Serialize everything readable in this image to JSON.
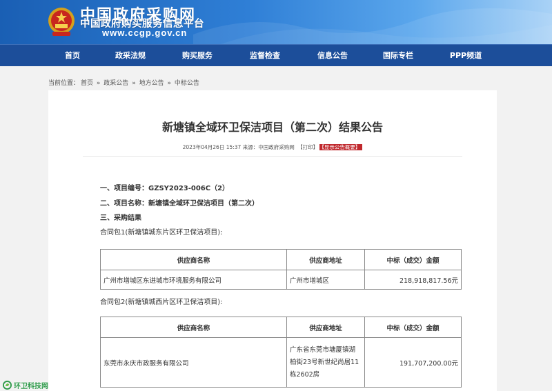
{
  "header": {
    "site_title": "中国政府采购网",
    "site_subtitle": "中国政府购买服务信息平台",
    "site_url": "www.ccgp.gov.cn"
  },
  "nav": {
    "items": [
      "首页",
      "政采法规",
      "购买服务",
      "监督检查",
      "信息公告",
      "国际专栏",
      "PPP频道"
    ]
  },
  "breadcrumb": {
    "label": "当前位置：",
    "items": [
      "首页",
      "政采公告",
      "地方公告",
      "中标公告"
    ],
    "separator": "»"
  },
  "article": {
    "title": "新塘镇全域环卫保洁项目（第二次）结果公告",
    "meta_date": "2023年04月26日 15:37 来源：",
    "meta_source": "中国政府采购网",
    "print_label": "【打印】",
    "summary_label": "【显示公告概要】",
    "sections": {
      "project_no": "一、项目编号：GZSY2023-006C（2）",
      "project_name": "二、项目名称：新塘镇全域环卫保洁项目（第二次）",
      "result": "三、采购结果",
      "package1": "合同包1(新塘镇城东片区环卫保洁项目):",
      "package2": "合同包2(新塘镇城西片区环卫保洁项目):"
    },
    "table_headers": [
      "供应商名称",
      "供应商地址",
      "中标（成交）金额"
    ],
    "table1": {
      "supplier": "广州市增城区东进城市环境服务有限公司",
      "address": "广州市增城区",
      "amount": "218,918,817.56元"
    },
    "table2": {
      "supplier": "东莞市永庆市政服务有限公司",
      "address": "广东省东莞市塘厦镇湖柏街23号新世纪尚居11栋2602房",
      "amount": "191,707,200.00元"
    }
  },
  "watermark": {
    "text": "环卫科技网"
  },
  "colors": {
    "header_blue": "#1a5fb4",
    "nav_blue": "#1c4e9a",
    "summary_red": "#c0282d",
    "watermark_green": "#2e9a4a"
  }
}
